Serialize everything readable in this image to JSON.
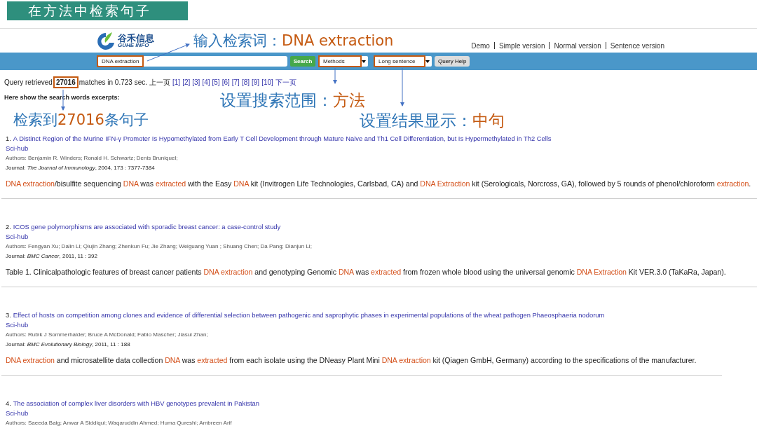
{
  "slide_title": "在方法中检索句子",
  "logo": {
    "name": "谷禾信息",
    "subtitle": "GUHE INFO"
  },
  "top_links": [
    "Demo",
    "Simple version",
    "Normal version",
    "Sentence version"
  ],
  "search_bar": {
    "query": "DNA extraction",
    "query_highlighted": true,
    "search_button": "Search",
    "scope": {
      "value": "Methods",
      "highlighted": true
    },
    "display": {
      "value": "Long sentence",
      "highlighted": true
    },
    "help_button": "Query Help"
  },
  "summary": {
    "prefix": "Query retrieved",
    "count": "27016",
    "count_highlighted": true,
    "suffix": "matches in 0.723 sec.",
    "prev": "上一页",
    "pages": [
      "[1]",
      "[2]",
      "[3]",
      "[4]",
      "[5]",
      "[6]",
      "[7]",
      "[8]",
      "[9]",
      "[10]"
    ],
    "next": "下一页",
    "excerpts_heading": "Here show the search words excerpts:"
  },
  "annotations": [
    {
      "kind": "query",
      "label": "输入检索词：",
      "value": "DNA extraction"
    },
    {
      "kind": "scope",
      "label": "设置搜索范围：",
      "value": "方法"
    },
    {
      "kind": "count",
      "label": "检索到",
      "value": "27016",
      "tail": "条句子"
    },
    {
      "kind": "display",
      "label": "设置结果显示：",
      "value": "中句"
    }
  ],
  "results": [
    {
      "number": "1.",
      "title": "A Distinct Region of the Murine IFN-γ Promoter Is Hypomethylated from Early T Cell Development through Mature Naive and Th1 Cell Differentiation, but Is Hypermethylated in Th2 Cells",
      "link": "Sci-hub",
      "authors": "Authors: Benjamin R. Winders; Ronald H. Schwartz; Denis Bruniquel;",
      "journal_label": "Journal:",
      "journal": "The Journal of Immunology",
      "journal_info": ", 2004, 173 : 7377-7384",
      "sentence": [
        {
          "text": "DNA extraction",
          "hit": true
        },
        {
          "text": "/bisulfite sequencing ",
          "hit": false
        },
        {
          "text": "DNA",
          "hit": true
        },
        {
          "text": " was ",
          "hit": false
        },
        {
          "text": "extracted",
          "hit": true
        },
        {
          "text": " with the Easy ",
          "hit": false
        },
        {
          "text": "DNA",
          "hit": true
        },
        {
          "text": " kit (Invitrogen Life Technologies, Carlsbad, CA) and ",
          "hit": false
        },
        {
          "text": "DNA Extraction",
          "hit": true
        },
        {
          "text": " kit (Serologicals, Norcross, GA), followed by 5 rounds of phenol/chloroform ",
          "hit": false
        },
        {
          "text": "extraction",
          "hit": true
        },
        {
          "text": ".",
          "hit": false
        }
      ]
    },
    {
      "number": "2.",
      "title": "ICOS gene polymorphisms are associated with sporadic breast cancer: a case-control study",
      "link": "Sci-hub",
      "authors": "Authors: Fengyan Xu; Dalin Li; Qiujin Zhang; Zhenkun Fu; Jie Zhang; Weiguang Yuan ; Shuang Chen; Da Pang; Dianjun Li;",
      "journal_label": "Journal:",
      "journal": "BMC Cancer",
      "journal_info": ", 2011, 11 : 392",
      "sentence": [
        {
          "text": "Table 1. Clinicalpathologic features of breast cancer patients ",
          "hit": false
        },
        {
          "text": "DNA extraction",
          "hit": true
        },
        {
          "text": " and genotyping Genomic ",
          "hit": false
        },
        {
          "text": "DNA",
          "hit": true
        },
        {
          "text": " was ",
          "hit": false
        },
        {
          "text": "extracted",
          "hit": true
        },
        {
          "text": " from frozen whole blood using the universal genomic ",
          "hit": false
        },
        {
          "text": "DNA Extraction",
          "hit": true
        },
        {
          "text": " Kit VER.3.0 (TaKaRa, Japan).",
          "hit": false
        }
      ]
    },
    {
      "number": "3.",
      "title": "Effect of hosts on competition among clones and evidence of differential selection between pathogenic and saprophytic phases in experimental populations of the wheat pathogen Phaeosphaeria nodorum",
      "link": "Sci-hub",
      "authors": "Authors: Rubik J Sommerhalder; Bruce A McDonald; Fabio Mascher; Jiasui Zhan;",
      "journal_label": "Journal:",
      "journal": "BMC Evolutionary Biology",
      "journal_info": ", 2011, 11 : 188",
      "sentence": [
        {
          "text": "DNA extraction",
          "hit": true
        },
        {
          "text": " and microsatellite data collection ",
          "hit": false
        },
        {
          "text": "DNA",
          "hit": true
        },
        {
          "text": " was ",
          "hit": false
        },
        {
          "text": "extracted",
          "hit": true
        },
        {
          "text": " from each isolate using the DNeasy Plant Mini ",
          "hit": false
        },
        {
          "text": "DNA extraction",
          "hit": true
        },
        {
          "text": " kit (Qiagen GmbH, Germany) according to the specifications of the manufacturer.",
          "hit": false
        }
      ]
    },
    {
      "number": "4.",
      "title": "The association of complex liver disorders with HBV genotypes prevalent in Pakistan",
      "link": "Sci-hub",
      "authors": "Authors: Saeeda Baig; Anwar A Siddiqui; Waqaruddin Ahmed; Huma Qureshi; Ambreen Arif"
    }
  ]
}
